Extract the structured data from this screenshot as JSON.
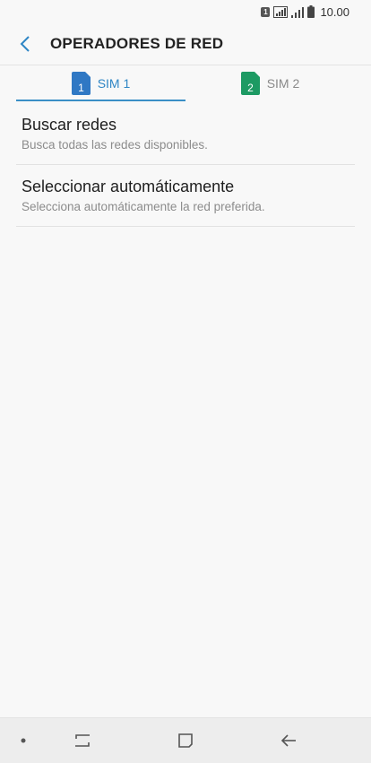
{
  "status_bar": {
    "sim_badge": "1",
    "time": "10.00",
    "icons": [
      "sim-indicator-icon",
      "signal-icon",
      "signal-icon",
      "battery-icon"
    ]
  },
  "header": {
    "title": "OPERADORES DE RED",
    "back_icon": "chevron-left-icon"
  },
  "tabs": [
    {
      "label": "SIM 1",
      "sim_number": "1",
      "icon_color": "#2f78c4",
      "active": true
    },
    {
      "label": "SIM 2",
      "sim_number": "2",
      "icon_color": "#1d9a63",
      "active": false
    }
  ],
  "list": [
    {
      "title": "Buscar redes",
      "subtitle": "Busca todas las redes disponibles."
    },
    {
      "title": "Seleccionar automáticamente",
      "subtitle": "Selecciona automáticamente la red preferida."
    }
  ],
  "nav_bar": {
    "icons": [
      "dot-icon",
      "recents-icon",
      "home-icon",
      "back-arrow-icon"
    ]
  },
  "colors": {
    "accent": "#3a8fc6",
    "background": "#f8f8f8"
  }
}
